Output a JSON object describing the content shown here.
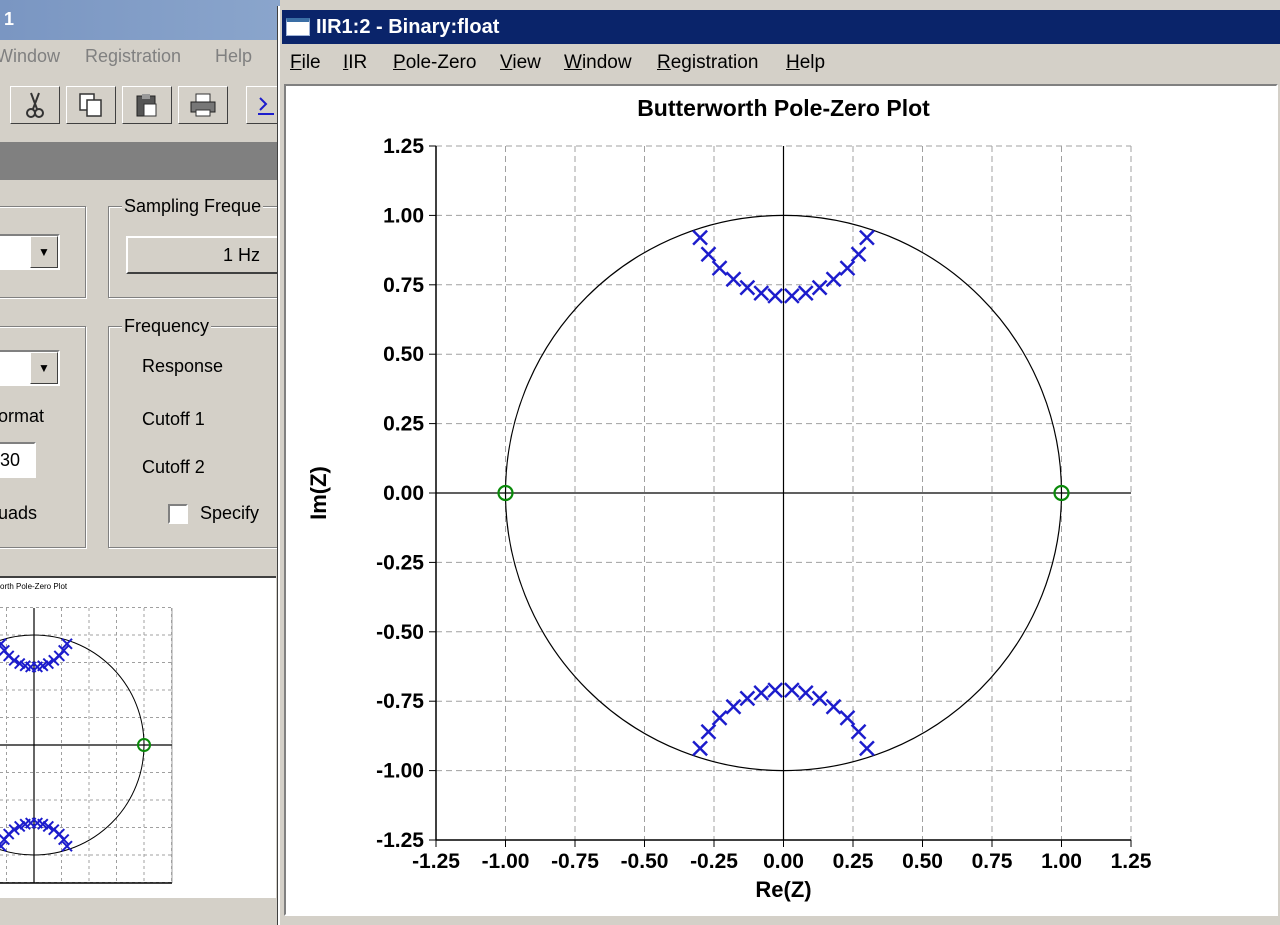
{
  "background_window": {
    "title": "1",
    "menu": [
      "Window",
      "Registration",
      "Help"
    ],
    "toolbar_icons": [
      "cut-icon",
      "copy-icon",
      "paste-icon",
      "print-icon",
      "import-icon"
    ],
    "sampling_frequency": {
      "group_label": "Sampling Freque",
      "value": "1 Hz"
    },
    "frequency": {
      "group_label": "Frequency",
      "response_label": "Response",
      "cutoff1_label": "Cutoff 1",
      "cutoff2_label": "Cutoff 2",
      "specify_label": "Specify"
    },
    "format_label": "ormat",
    "field_value": "30",
    "quads_label": "uads",
    "mini_plot_title": "orth Pole-Zero Plot"
  },
  "main_window": {
    "title": "IIR1:2 - Binary:float",
    "menu": [
      {
        "label": "File",
        "accel": "F",
        "rest": "ile"
      },
      {
        "label": "IIR",
        "accel": "I",
        "rest": "IR"
      },
      {
        "label": "Pole-Zero",
        "accel": "P",
        "rest": "ole-Zero"
      },
      {
        "label": "View",
        "accel": "V",
        "rest": "iew"
      },
      {
        "label": "Window",
        "accel": "W",
        "rest": "indow"
      },
      {
        "label": "Registration",
        "accel": "R",
        "rest": "egistration"
      },
      {
        "label": "Help",
        "accel": "H",
        "rest": "elp"
      }
    ]
  },
  "chart_data": {
    "type": "scatter",
    "title": "Butterworth Pole-Zero Plot",
    "xlabel": "Re(Z)",
    "ylabel": "Im(Z)",
    "xlim": [
      -1.25,
      1.25
    ],
    "ylim": [
      -1.25,
      1.25
    ],
    "x_ticks": [
      "-1.25",
      "-1.00",
      "-0.75",
      "-0.50",
      "-0.25",
      "0.00",
      "0.25",
      "0.50",
      "0.75",
      "1.00",
      "1.25"
    ],
    "y_ticks": [
      "1.25",
      "1.00",
      "0.75",
      "0.50",
      "0.25",
      "0.00",
      "-0.25",
      "-0.50",
      "-0.75",
      "-1.00",
      "-1.25"
    ],
    "grid": true,
    "unit_circle": true,
    "colors": {
      "poles": "#1c1ccc",
      "zeros": "#0a8a0a",
      "grid": "#a0a0a0"
    },
    "series": [
      {
        "marker": "x",
        "points": [
          [
            -0.3,
            0.92
          ],
          [
            -0.27,
            0.86
          ],
          [
            -0.23,
            0.81
          ],
          [
            -0.18,
            0.77
          ],
          [
            -0.13,
            0.74
          ],
          [
            -0.08,
            0.72
          ],
          [
            -0.03,
            0.71
          ],
          [
            0.03,
            0.71
          ],
          [
            0.08,
            0.72
          ],
          [
            0.13,
            0.74
          ],
          [
            0.18,
            0.77
          ],
          [
            0.23,
            0.81
          ],
          [
            0.27,
            0.86
          ],
          [
            0.3,
            0.92
          ],
          [
            -0.3,
            -0.92
          ],
          [
            -0.27,
            -0.86
          ],
          [
            -0.23,
            -0.81
          ],
          [
            -0.18,
            -0.77
          ],
          [
            -0.13,
            -0.74
          ],
          [
            -0.08,
            -0.72
          ],
          [
            -0.03,
            -0.71
          ],
          [
            0.03,
            -0.71
          ],
          [
            0.08,
            -0.72
          ],
          [
            0.13,
            -0.74
          ],
          [
            0.18,
            -0.77
          ],
          [
            0.23,
            -0.81
          ],
          [
            0.27,
            -0.86
          ],
          [
            0.3,
            -0.92
          ]
        ]
      },
      {
        "marker": "o",
        "points": [
          [
            -1.0,
            0.0
          ],
          [
            1.0,
            0.0
          ]
        ]
      }
    ]
  }
}
